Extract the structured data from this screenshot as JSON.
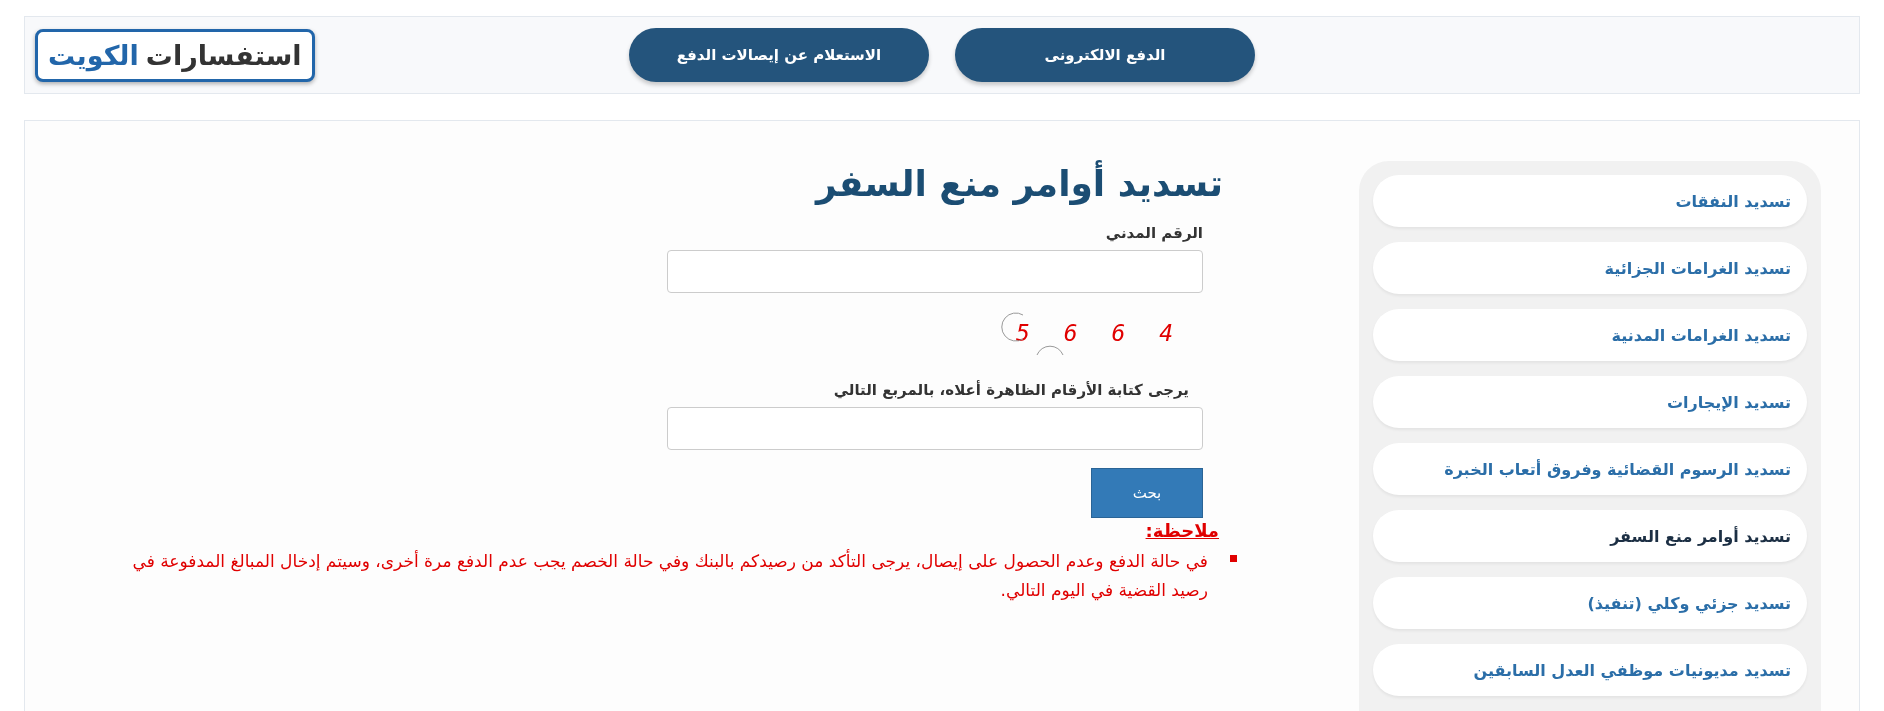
{
  "header": {
    "logo": {
      "part_1": "استفسارات",
      "part_2": "الكويت"
    },
    "nav_buttons": [
      {
        "label": "الدفع الالكترونى"
      },
      {
        "label": "الاستعلام عن إيصالات الدفع"
      }
    ]
  },
  "sidebar": {
    "items": [
      {
        "label": "تسديد النفقات",
        "selected": false
      },
      {
        "label": "تسديد الغرامات الجزائية",
        "selected": false
      },
      {
        "label": "تسديد الغرامات المدنية",
        "selected": false
      },
      {
        "label": "تسديد الإيجارات",
        "selected": false
      },
      {
        "label": "تسديد الرسوم القضائية وفروق أتعاب الخبرة",
        "selected": false
      },
      {
        "label": "تسديد أوامر منع السفر",
        "selected": true
      },
      {
        "label": "تسديد جزئي وكلي (تنفيذ)",
        "selected": false
      },
      {
        "label": "تسديد مديونيات موظفي العدل السابقين",
        "selected": false
      }
    ]
  },
  "form": {
    "title": "تسديد أوامر منع السفر",
    "civil_id_label": "الرقم المدني",
    "captcha": "5 6 6 4",
    "captcha_label": "يرجى كتابة الأرقام الظاهرة أعلاه، بالمربع التالي",
    "search_button": "بحث",
    "note_heading": "ملاحظة:",
    "notes": [
      "في حالة الدفع وعدم الحصول على إيصال، يرجى التأكد من رصيدكم بالبنك وفي حالة الخصم يجب عدم الدفع مرة أخرى، وسيتم إدخال المبالغ المدفوعة في رصيد القضية في اليوم التالي."
    ]
  }
}
